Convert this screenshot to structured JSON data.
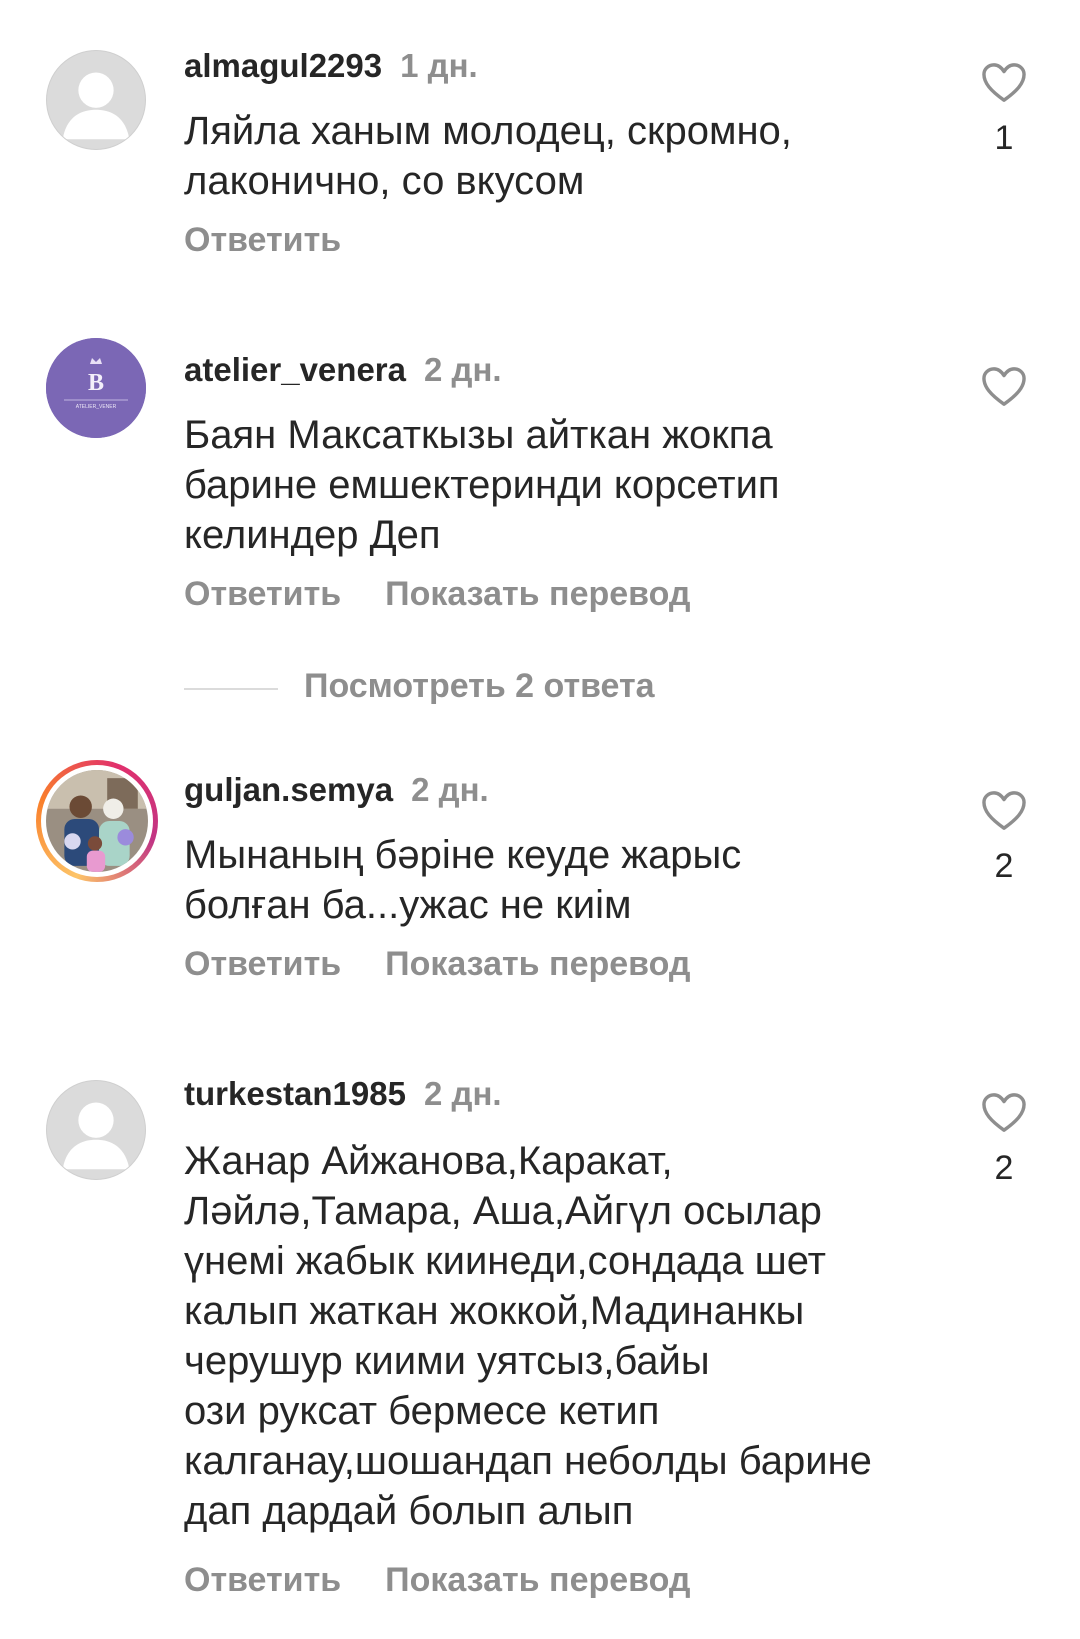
{
  "comments": [
    {
      "username": "almagul2293",
      "time": "1 дн.",
      "text": "Ляйла ханым молодец, скромно,\nлаконично, со вкусом",
      "reply_label": "Ответить",
      "likes": "1",
      "avatar": "default-avatar-icon"
    },
    {
      "username": "atelier_venera",
      "time": "2 дн.",
      "text": "Баян Максаткызы айткан жокпа\nбарине емшектеринди корсетип\nкелиндер Деп",
      "reply_label": "Ответить",
      "translate_label": "Показать перевод",
      "avatar": "atelier-venera-logo",
      "view_replies": "Посмотреть 2 ответа"
    },
    {
      "username": "guljan.semya",
      "time": "2 дн.",
      "text": "Мынаның бәріне кеуде жарыс\nболған ба...ужас не киім",
      "reply_label": "Ответить",
      "translate_label": "Показать перевод",
      "likes": "2",
      "avatar": "family-photo-story"
    },
    {
      "username": "turkestan1985",
      "time": "2 дн.",
      "text": "Жанар Айжанова,Каракат,\nЛәйлә,Тамара, Аша,Айгүл осылар\nүнемі жабык киинеди,сондада шет\nкалып жаткан жоккой,Мадинанкы\nчерушур киими уятсыз,байы\nози руксат бермесе кетип\nкалганау,шошандап неболды барине\nдап дардай болып алып",
      "reply_label": "Ответить",
      "translate_label": "Показать перевод",
      "likes": "2",
      "avatar": "default-avatar-icon"
    }
  ],
  "colors": {
    "text": "#262626",
    "secondary": "#8e8e8e",
    "avatar_placeholder": "#dbdbdb",
    "brand_avatar": "#7b67b5"
  }
}
